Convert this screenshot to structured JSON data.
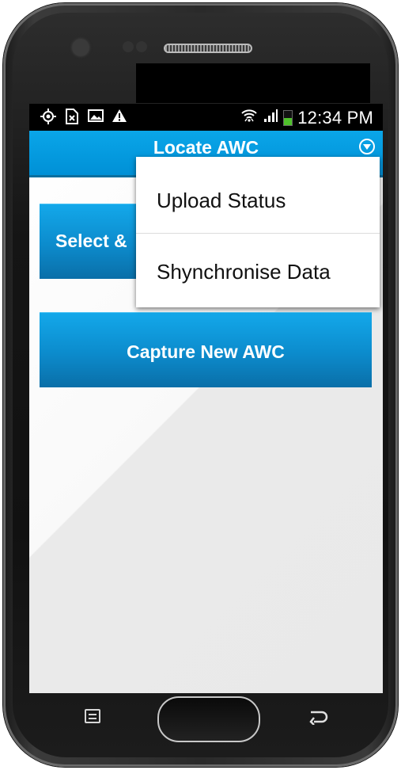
{
  "status_bar": {
    "time": "12:34 PM",
    "icons": [
      "gps-icon",
      "no-sim-icon",
      "image-icon",
      "warning-icon",
      "wifi-icon",
      "signal-icon",
      "battery-icon"
    ],
    "battery_color": "#4fc12b"
  },
  "action_bar": {
    "title": "Locate AWC",
    "overflow_icon": "chevron-down-circle-icon",
    "color": "#0aa6e9"
  },
  "buttons": {
    "select_label": "Select &",
    "capture_label": "Capture New AWC"
  },
  "menu": {
    "items": [
      {
        "label": "Upload Status"
      },
      {
        "label": "Shynchronise Data"
      }
    ]
  },
  "nav_bar": {
    "icons": [
      "menu-icon",
      "home-button",
      "back-icon"
    ]
  }
}
